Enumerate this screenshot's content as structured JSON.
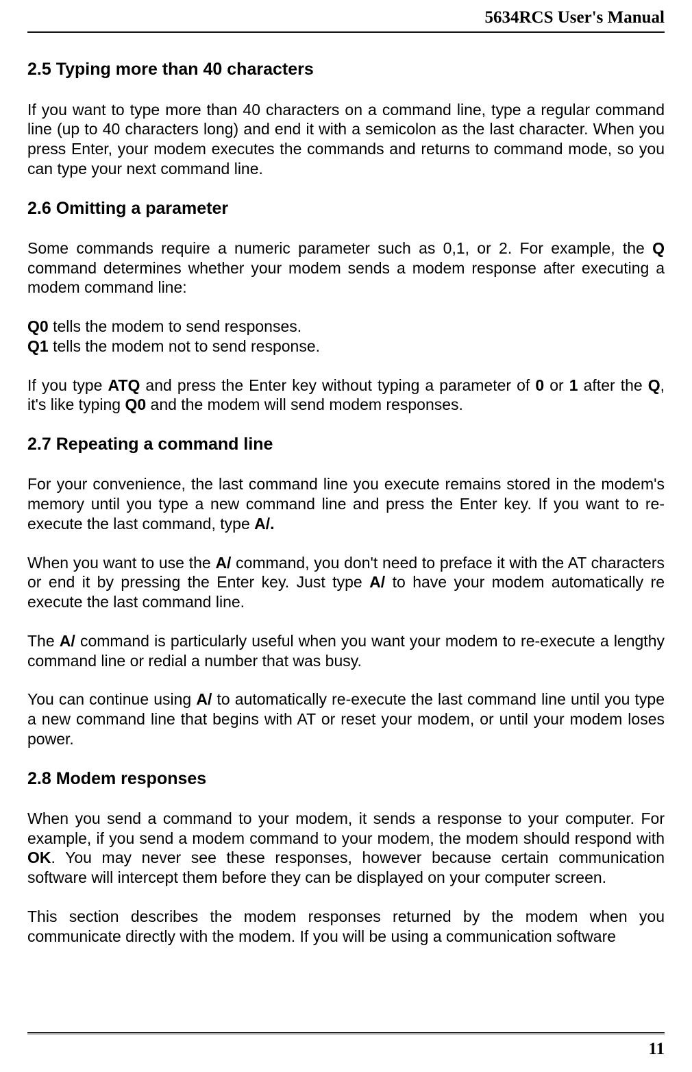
{
  "header": {
    "title": "5634RCS User's Manual"
  },
  "sections": {
    "s25": {
      "heading": "2.5 Typing more than 40 characters",
      "p1": "If you want to type more than 40 characters on a command line, type a regular command line (up to 40 characters long) and end it with a semicolon as the last character. When you press Enter, your modem executes the commands and returns to command mode, so you can type your next command line."
    },
    "s26": {
      "heading": "2.6 Omitting a parameter",
      "p1_a": "Some commands require a numeric parameter such as 0,1, or 2. For example, the ",
      "p1_b": "Q",
      "p1_c": " command determines whether your modem sends a modem response after executing a modem command line:",
      "line1_a": "Q0",
      "line1_b": " tells the modem to send responses.",
      "line2_a": "Q1",
      "line2_b": " tells the modem not to send response.",
      "p2_a": "If you type ",
      "p2_b": "ATQ",
      "p2_c": " and press the Enter key without typing a parameter of ",
      "p2_d": "0",
      "p2_e": " or ",
      "p2_f": "1",
      "p2_g": " after the ",
      "p2_h": "Q",
      "p2_i": ", it's like typing ",
      "p2_j": "Q0",
      "p2_k": " and the modem will send modem responses."
    },
    "s27": {
      "heading": "2.7 Repeating a command line",
      "p1_a": "For your convenience, the last command line you execute remains stored in the modem's memory until you type a new command line and press the Enter key. If you want to re-execute the last command, type ",
      "p1_b": "A/.",
      "p2_a": "When you want to use the ",
      "p2_b": "A/",
      "p2_c": " command, you don't need to preface it with the AT characters or end it by pressing the Enter key. Just type ",
      "p2_d": "A/",
      "p2_e": " to have your modem automatically re execute the last command line.",
      "p3_a": "The ",
      "p3_b": "A/",
      "p3_c": " command is particularly useful when you want your modem to re-execute a lengthy command line or redial a number that was busy.",
      "p4_a": "You can continue using ",
      "p4_b": "A/",
      "p4_c": " to automatically re-execute the last command line until you type a new command line that begins with AT or reset your modem, or until your modem loses power."
    },
    "s28": {
      "heading": "2.8 Modem responses",
      "p1_a": "When you send a command to your modem, it sends a response to your computer. For example, if you send a modem command to your modem, the modem should respond with ",
      "p1_b": "OK",
      "p1_c": ". You may never see these responses, however because certain communication software will intercept them before they can be displayed on your computer screen.",
      "p2": "This section describes the modem responses returned by the modem when you communicate directly with the modem. If you will be using a communication software"
    }
  },
  "footer": {
    "page": "11"
  }
}
